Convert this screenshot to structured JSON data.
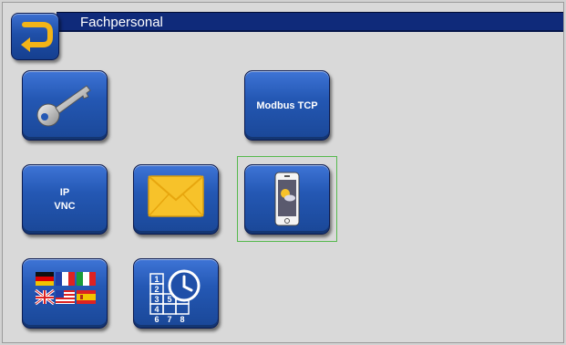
{
  "header": {
    "title": "Fachpersonal"
  },
  "tiles": {
    "modbus": {
      "label": "Modbus TCP"
    },
    "ipvnc": {
      "line1": "IP",
      "line2": "VNC"
    },
    "calendar": {
      "digits": [
        "1",
        "2",
        "3",
        "4",
        "5",
        "6",
        "7",
        "8"
      ]
    }
  },
  "icons": {
    "back": "return-arrow-icon",
    "key": "key-icon",
    "mail": "envelope-icon",
    "app": "smartphone-weather-icon",
    "languages": "language-flags-icon",
    "timer": "clock-calendar-icon"
  },
  "colors": {
    "accent": "#0f2a7a",
    "tile": "#2458b4",
    "selection": "#56b94e",
    "background": "#d9d9d9"
  }
}
